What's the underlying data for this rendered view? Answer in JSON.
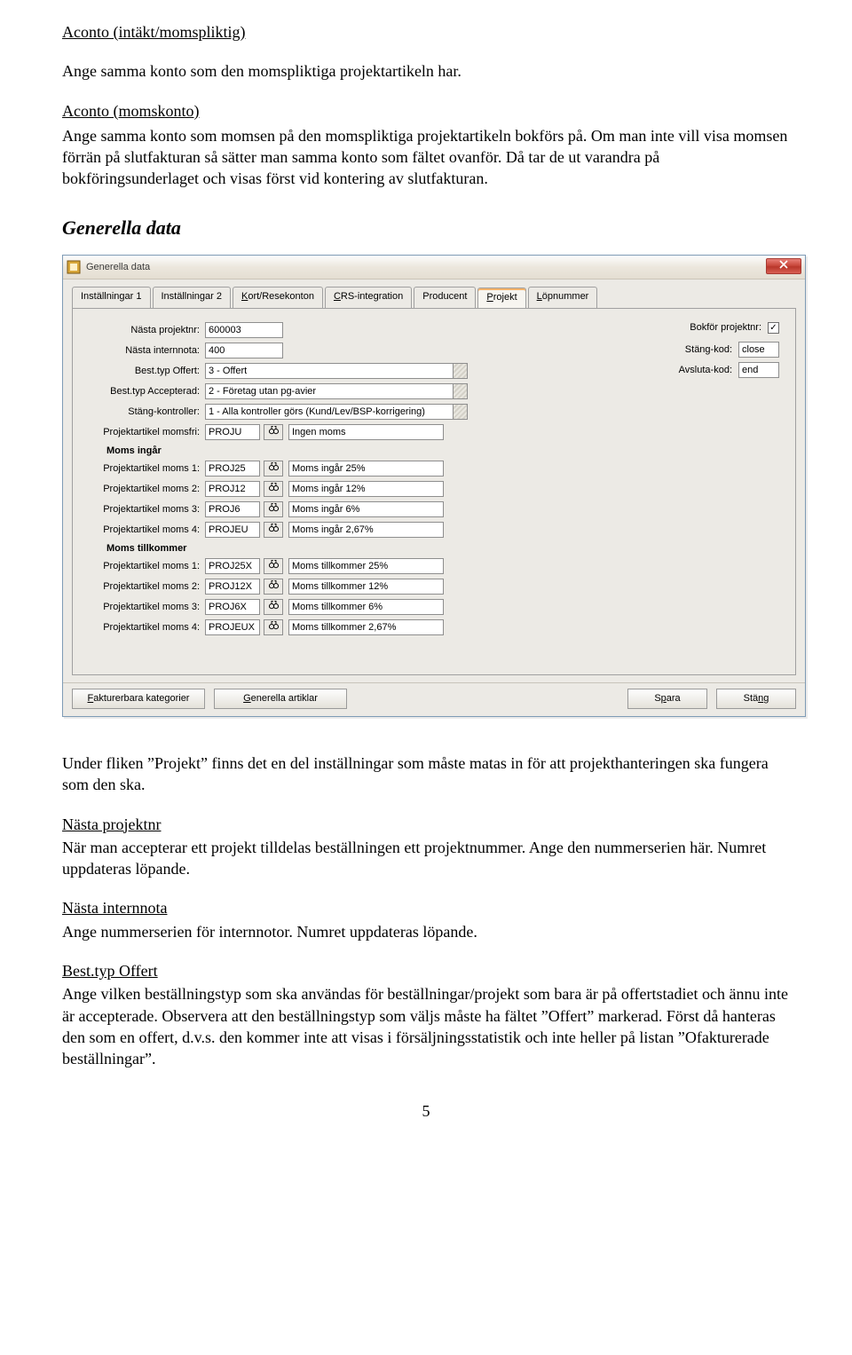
{
  "intro": {
    "h1": "Aconto (intäkt/momspliktig)",
    "p1": "Ange samma konto som den momspliktiga projektartikeln har.",
    "h2": "Aconto (momskonto)",
    "p2": "Ange samma konto som momsen på den momspliktiga projektartikeln bokförs på. Om man inte vill visa momsen förrän på slutfakturan så sätter man samma konto som fältet ovanför. Då tar de ut varandra på bokföringsunderlaget och visas först vid kontering av slutfakturan."
  },
  "section_title": "Generella data",
  "dialog": {
    "title": "Generella data",
    "tabs": [
      "Inställningar 1",
      "Inställningar 2",
      "Kort/Resekonton",
      "CRS-integration",
      "Producent",
      "Projekt",
      "Löpnummer"
    ],
    "active_tab_index": 5,
    "right": {
      "bokfor_label": "Bokför projektnr:",
      "bokfor_checked": true,
      "stang_label": "Stäng-kod:",
      "stang_value": "close",
      "avsluta_label": "Avsluta-kod:",
      "avsluta_value": "end"
    },
    "rows": [
      {
        "label": "Nästa projektnr:",
        "value": "600003",
        "w": "w-short",
        "type": "text"
      },
      {
        "label": "Nästa internnota:",
        "value": "400",
        "w": "w-short",
        "type": "text"
      },
      {
        "label": "Best.typ Offert:",
        "value": "3 - Offert",
        "type": "select"
      },
      {
        "label": "Best.typ Accepterad:",
        "value": "2 - Företag utan pg-avier",
        "type": "select"
      },
      {
        "label": "Stäng-kontroller:",
        "value": "1 - Alla kontroller görs (Kund/Lev/BSP-korrigering)",
        "type": "select"
      },
      {
        "label": "Projektartikel momsfri:",
        "value": "PROJU",
        "type": "lookup",
        "desc": "Ingen moms"
      }
    ],
    "group1_title": "Moms ingår",
    "group1": [
      {
        "label": "Projektartikel moms 1:",
        "value": "PROJ25",
        "desc": "Moms ingår 25%"
      },
      {
        "label": "Projektartikel moms 2:",
        "value": "PROJ12",
        "desc": "Moms ingår 12%"
      },
      {
        "label": "Projektartikel moms 3:",
        "value": "PROJ6",
        "desc": "Moms ingår 6%"
      },
      {
        "label": "Projektartikel moms 4:",
        "value": "PROJEU",
        "desc": "Moms ingår 2,67%"
      }
    ],
    "group2_title": "Moms tillkommer",
    "group2": [
      {
        "label": "Projektartikel moms 1:",
        "value": "PROJ25X",
        "desc": "Moms tillkommer 25%"
      },
      {
        "label": "Projektartikel moms 2:",
        "value": "PROJ12X",
        "desc": "Moms tillkommer 12%"
      },
      {
        "label": "Projektartikel moms 3:",
        "value": "PROJ6X",
        "desc": "Moms tillkommer 6%"
      },
      {
        "label": "Projektartikel moms 4:",
        "value": "PROJEUX",
        "desc": "Moms tillkommer 2,67%"
      }
    ],
    "buttons": {
      "kategorier": "Fakturerbara kategorier",
      "artiklar": "Generella artiklar",
      "spara": "Spara",
      "stang": "Stäng"
    }
  },
  "below": {
    "p1": "Under fliken ”Projekt” finns det en del inställningar som måste matas in för att projekthanteringen ska fungera som den ska.",
    "h1": "Nästa projektnr",
    "p2": "När man accepterar ett projekt tilldelas beställningen ett projektnummer. Ange den nummerserien här. Numret uppdateras löpande.",
    "h2": "Nästa internnota",
    "p3": "Ange nummerserien för internnotor. Numret uppdateras löpande.",
    "h3": "Best.typ Offert",
    "p4": "Ange vilken beställningstyp som ska användas för beställningar/projekt som bara är på offertstadiet och ännu inte är accepterade. Observera att den beställningstyp som väljs måste ha fältet ”Offert” markerad. Först då hanteras den som en offert, d.v.s. den kommer inte att visas i försäljningsstatistik och inte heller på listan ”Ofakturerade beställningar”."
  },
  "page_number": "5"
}
